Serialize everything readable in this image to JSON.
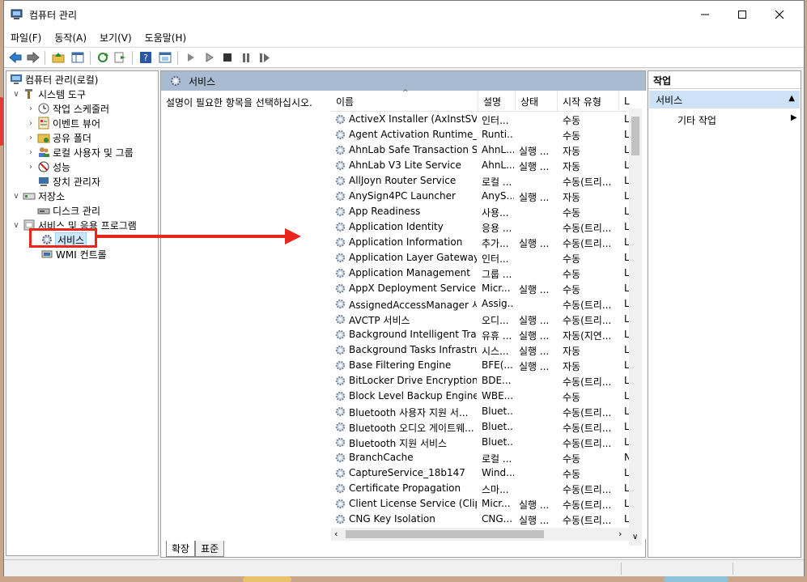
{
  "window": {
    "title": "컴퓨터 관리",
    "menus": [
      "파일(F)",
      "동작(A)",
      "보기(V)",
      "도움말(H)"
    ]
  },
  "tree": {
    "items": [
      {
        "label": "컴퓨터 관리(로컬)",
        "icon": "computer-management-icon"
      },
      {
        "label": "시스템 도구",
        "icon": "tools-icon"
      },
      {
        "label": "작업 스케줄러",
        "icon": "clock-icon"
      },
      {
        "label": "이벤트 뷰어",
        "icon": "event-viewer-icon"
      },
      {
        "label": "공유 폴더",
        "icon": "shared-folder-icon"
      },
      {
        "label": "로컬 사용자 및 그룹",
        "icon": "users-icon"
      },
      {
        "label": "성능",
        "icon": "performance-icon"
      },
      {
        "label": "장치 관리자",
        "icon": "device-manager-icon"
      },
      {
        "label": "저장소",
        "icon": "storage-icon"
      },
      {
        "label": "디스크 관리",
        "icon": "disk-icon"
      },
      {
        "label": "서비스 및 응용 프로그램",
        "icon": "services-apps-icon"
      },
      {
        "label": "서비스",
        "icon": "gear-icon"
      },
      {
        "label": "WMI 컨트롤",
        "icon": "wmi-icon"
      }
    ]
  },
  "center": {
    "header": "서비스",
    "description": "설명이 필요한 항목을 선택하십시오.",
    "columns": [
      "이름",
      "설명",
      "상태",
      "시작 유형",
      "L"
    ],
    "rows": [
      {
        "name": "ActiveX Installer (AxInstSV)",
        "desc": "인터...",
        "status": "",
        "start": "수동",
        "logon": "L"
      },
      {
        "name": "Agent Activation Runtime_...",
        "desc": "Runti...",
        "status": "",
        "start": "수동",
        "logon": "L"
      },
      {
        "name": "AhnLab Safe Transaction S...",
        "desc": "AhnL...",
        "status": "실행 ...",
        "start": "자동",
        "logon": "L"
      },
      {
        "name": "AhnLab V3 Lite Service",
        "desc": "AhnL...",
        "status": "실행 ...",
        "start": "자동",
        "logon": "L"
      },
      {
        "name": "AllJoyn Router Service",
        "desc": "로컬 ...",
        "status": "",
        "start": "수동(트리...",
        "logon": "L"
      },
      {
        "name": "AnySign4PC Launcher",
        "desc": "AnyS...",
        "status": "실행 ...",
        "start": "자동",
        "logon": "L"
      },
      {
        "name": "App Readiness",
        "desc": "사용...",
        "status": "",
        "start": "수동",
        "logon": "L"
      },
      {
        "name": "Application Identity",
        "desc": "응용 ...",
        "status": "",
        "start": "수동(트리...",
        "logon": "L"
      },
      {
        "name": "Application Information",
        "desc": "추가...",
        "status": "실행 ...",
        "start": "수동(트리...",
        "logon": "L"
      },
      {
        "name": "Application Layer Gateway ...",
        "desc": "인터...",
        "status": "",
        "start": "수동",
        "logon": "L"
      },
      {
        "name": "Application Management",
        "desc": "그룹 ...",
        "status": "",
        "start": "수동",
        "logon": "L"
      },
      {
        "name": "AppX Deployment Service ...",
        "desc": "Micr...",
        "status": "실행 ...",
        "start": "수동",
        "logon": "L"
      },
      {
        "name": "AssignedAccessManager 서...",
        "desc": "Assig...",
        "status": "",
        "start": "수동(트리...",
        "logon": "L"
      },
      {
        "name": "AVCTP 서비스",
        "desc": "오디...",
        "status": "실행 ...",
        "start": "수동(트리...",
        "logon": "L"
      },
      {
        "name": "Background Intelligent Tra...",
        "desc": "유휴 ...",
        "status": "실행 ...",
        "start": "자동(지연...",
        "logon": "L"
      },
      {
        "name": "Background Tasks Infrastru...",
        "desc": "시스...",
        "status": "실행 ...",
        "start": "자동",
        "logon": "L"
      },
      {
        "name": "Base Filtering Engine",
        "desc": "BFE(...",
        "status": "실행 ...",
        "start": "자동",
        "logon": "L"
      },
      {
        "name": "BitLocker Drive Encryption ...",
        "desc": "BDE...",
        "status": "",
        "start": "수동(트리...",
        "logon": "L"
      },
      {
        "name": "Block Level Backup Engine ...",
        "desc": "WBE...",
        "status": "",
        "start": "수동",
        "logon": "L"
      },
      {
        "name": "Bluetooth 사용자 지원 서...",
        "desc": "Bluet...",
        "status": "",
        "start": "수동(트리...",
        "logon": "L"
      },
      {
        "name": "Bluetooth 오디오 게이트웨...",
        "desc": "Bluet...",
        "status": "",
        "start": "수동(트리...",
        "logon": "L"
      },
      {
        "name": "Bluetooth 지원 서비스",
        "desc": "Bluet...",
        "status": "",
        "start": "수동(트리...",
        "logon": "L"
      },
      {
        "name": "BranchCache",
        "desc": "로컬 ...",
        "status": "",
        "start": "수동",
        "logon": "N"
      },
      {
        "name": "CaptureService_18b147",
        "desc": "Wind...",
        "status": "",
        "start": "수동",
        "logon": "L"
      },
      {
        "name": "Certificate Propagation",
        "desc": "스마...",
        "status": "",
        "start": "수동(트리...",
        "logon": "L"
      },
      {
        "name": "Client License Service (Clip...",
        "desc": "Micr...",
        "status": "실행 ...",
        "start": "수동(트리...",
        "logon": "L"
      },
      {
        "name": "CNG Key Isolation",
        "desc": "CNG...",
        "status": "실행 ...",
        "start": "수동(트리...",
        "logon": "L"
      }
    ],
    "tabs": [
      "확장",
      "표준"
    ]
  },
  "actions": {
    "title": "작업",
    "section": "서비스",
    "item": "기타 작업"
  }
}
